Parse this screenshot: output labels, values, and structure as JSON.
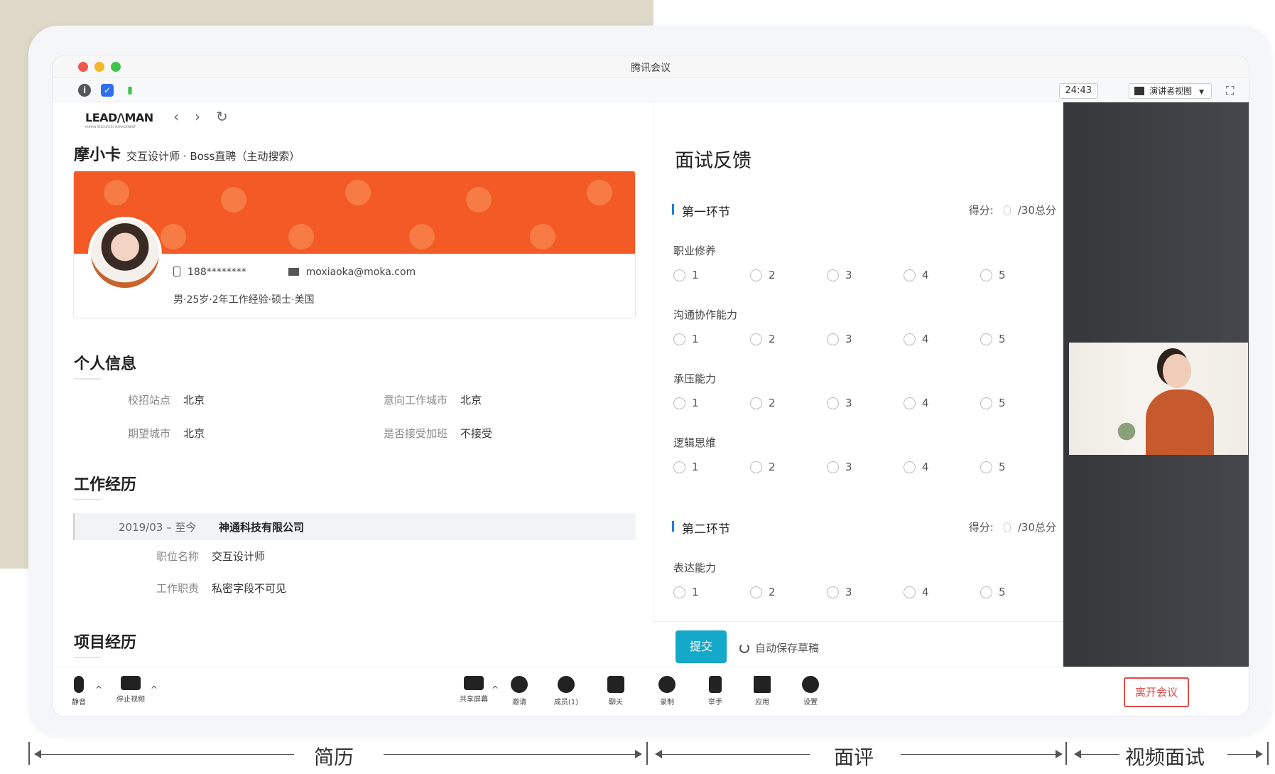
{
  "window": {
    "title": "腾讯会议"
  },
  "infobar": {
    "timer": "24:43",
    "view_mode": "演讲者视图"
  },
  "resume": {
    "brand": "LEAD/\\MAN",
    "brand_tag": "HUMAN RESOURCES MANAGEMENT",
    "candidate_name": "摩小卡",
    "candidate_role": "交互设计师 · Boss直聘（主动搜索）",
    "phone": "188********",
    "email": "moxiaoka@moka.com",
    "summary": "男·25岁·2年工作经验·硕士·美国",
    "personal_title": "个人信息",
    "personal": [
      {
        "k": "校招站点",
        "v": "北京"
      },
      {
        "k": "意向工作城市",
        "v": "北京"
      },
      {
        "k": "期望城市",
        "v": "北京"
      },
      {
        "k": "是否接受加班",
        "v": "不接受"
      }
    ],
    "work_title": "工作经历",
    "work": {
      "period": "2019/03 – 至今",
      "company": "神通科技有限公司",
      "position_k": "职位名称",
      "position_v": "交互设计师",
      "duty_k": "工作职责",
      "duty_v": "私密字段不可见"
    },
    "project_title": "项目经历"
  },
  "feedback": {
    "title": "面试反馈",
    "score_label": "得分:",
    "score_total": "/30总分",
    "stage1": "第一环节",
    "stage2": "第二环节",
    "items": [
      "职业修养",
      "沟通协作能力",
      "承压能力",
      "逻辑思维",
      "表达能力"
    ],
    "options": [
      "1",
      "2",
      "3",
      "4",
      "5"
    ],
    "submit": "提交",
    "autosave": "自动保存草稿"
  },
  "toolbar": {
    "mute": "静音",
    "stop_video": "停止视频",
    "share": "共享屏幕",
    "invite": "邀请",
    "members": "成员(1)",
    "chat": "聊天",
    "record": "录制",
    "raise_hand": "举手",
    "apps": "应用",
    "settings": "设置",
    "leave": "离开会议"
  },
  "labels": {
    "resume": "简历",
    "review": "面评",
    "video": "视频面试"
  }
}
